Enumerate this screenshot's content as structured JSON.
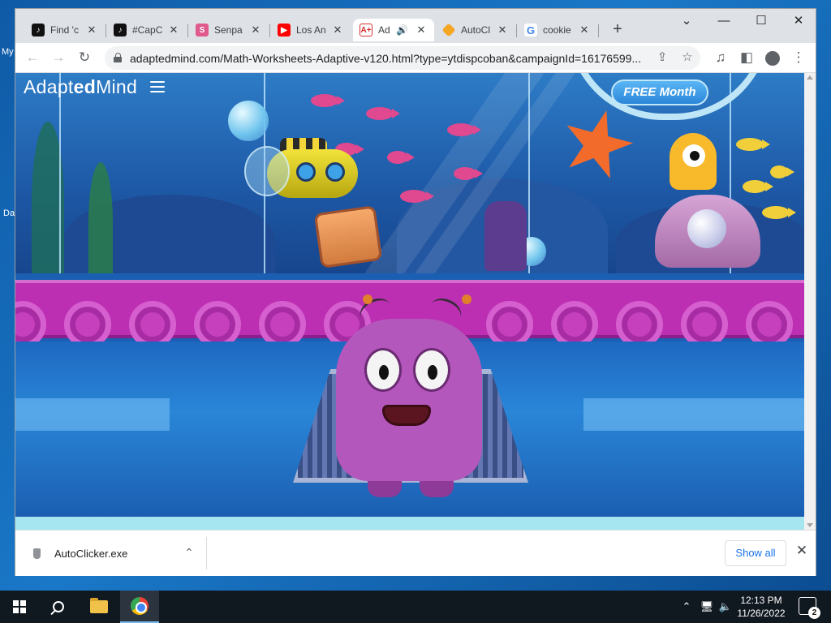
{
  "desktop": {
    "labels": [
      "My",
      "Da"
    ]
  },
  "tabs": [
    {
      "title": "Find 'c",
      "icon": "tiktok-icon"
    },
    {
      "title": "#CapC",
      "icon": "tiktok-icon"
    },
    {
      "title": "Senpa",
      "icon": "senpai-icon"
    },
    {
      "title": "Los An",
      "icon": "youtube-icon"
    },
    {
      "title": "Ad",
      "icon": "adaptedmind-icon",
      "active": true,
      "audio": true
    },
    {
      "title": "AutoCl",
      "icon": "autoclicker-icon"
    },
    {
      "title": "cookie",
      "icon": "google-icon"
    }
  ],
  "toolbar": {
    "url": "adaptedmind.com/Math-Worksheets-Adaptive-v120.html?type=ytdispcoban&campaignId=16176599..."
  },
  "page": {
    "brand_pre": "Adapt",
    "brand_bold": "ed",
    "brand_post": "Mind",
    "free_month": "FREE Month"
  },
  "downloads": {
    "file_name": "AutoClicker.exe",
    "show_all": "Show all"
  },
  "taskbar": {
    "time": "12:13 PM",
    "date": "11/26/2022",
    "notification_count": "2"
  },
  "colors": {
    "accent": "#1a73e8",
    "monster": "#b457bd",
    "wall": "#bc2fb2"
  }
}
